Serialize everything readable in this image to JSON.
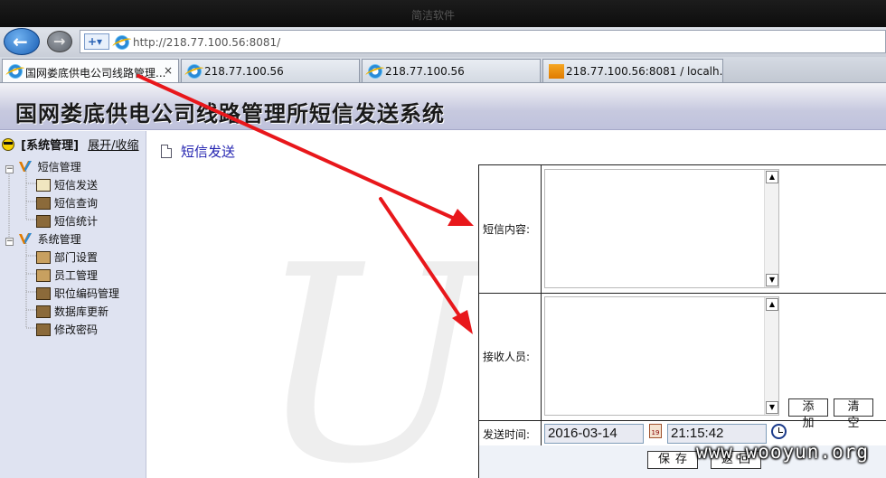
{
  "window": {
    "title": "简洁软件"
  },
  "address_bar": {
    "url": "http://218.77.100.56:8081/"
  },
  "tabs": [
    {
      "label": "国网娄底供电公司线路管理...",
      "close": "×",
      "icon": "ie-icon"
    },
    {
      "label": "218.77.100.56",
      "icon": "ie-icon"
    },
    {
      "label": "218.77.100.56",
      "icon": "ie-icon"
    },
    {
      "label": "218.77.100.56:8081 / localh...",
      "icon": "pma-icon"
    }
  ],
  "header": {
    "title": "国网娄底供电公司线路管理所短信发送系统"
  },
  "sidebar": {
    "system_label": "[系统管理]",
    "toggle_label": "展开/收缩",
    "groups": [
      {
        "label": "短信管理",
        "items": [
          "短信发送",
          "短信查询",
          "短信统计"
        ]
      },
      {
        "label": "系统管理",
        "items": [
          "部门设置",
          "员工管理",
          "职位编码管理",
          "数据库更新",
          "修改密码"
        ]
      }
    ]
  },
  "main": {
    "page_title": "短信发送",
    "form": {
      "content_label": "短信内容:",
      "recipients_label": "接收人员:",
      "add_button": "添加",
      "clear_button": "清空",
      "send_time_label": "发送时间:",
      "date_value": "2016-03-14",
      "time_value": "21:15:42",
      "save_button": "保存",
      "back_button": "返回"
    }
  },
  "watermark": "www.wooyun.org",
  "colors": {
    "annotation_arrows": "#e8171b",
    "header_gradient": "#c7c9df",
    "sidebar_bg": "#dfe3f1",
    "title_blue": "#2323b0"
  }
}
